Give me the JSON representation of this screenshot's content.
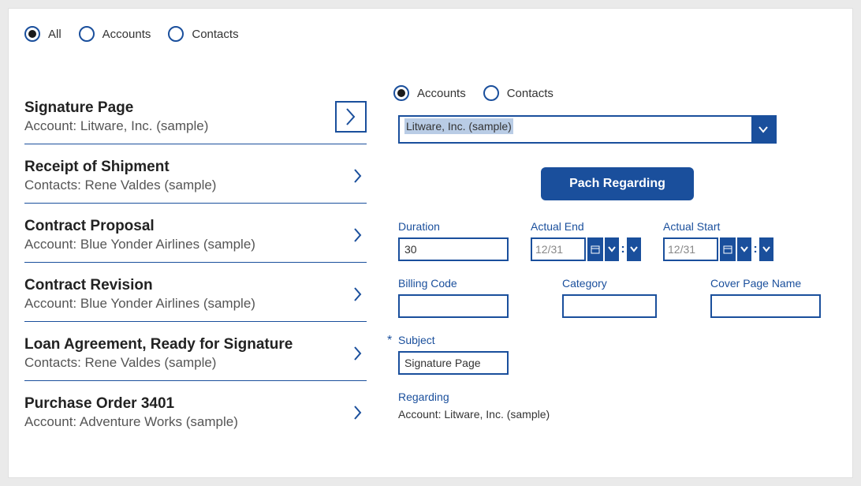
{
  "topFilters": {
    "all": "All",
    "accounts": "Accounts",
    "contacts": "Contacts",
    "selected": "all"
  },
  "list": [
    {
      "title": "Signature Page",
      "sub": "Account: Litware, Inc. (sample)",
      "boxed": true
    },
    {
      "title": "Receipt of Shipment",
      "sub": "Contacts: Rene Valdes (sample)",
      "boxed": false
    },
    {
      "title": "Contract Proposal",
      "sub": "Account: Blue Yonder Airlines (sample)",
      "boxed": false
    },
    {
      "title": "Contract Revision",
      "sub": "Account: Blue Yonder Airlines (sample)",
      "boxed": false
    },
    {
      "title": "Loan Agreement, Ready for Signature",
      "sub": "Contacts: Rene Valdes (sample)",
      "boxed": false
    },
    {
      "title": "Purchase Order 3401",
      "sub": "Account: Adventure Works (sample)",
      "boxed": false
    }
  ],
  "rightFilters": {
    "accounts": "Accounts",
    "contacts": "Contacts",
    "selected": "accounts"
  },
  "dropdown": {
    "value": "Litware, Inc. (sample)"
  },
  "actionButton": "Pach Regarding",
  "fields": {
    "duration": {
      "label": "Duration",
      "value": "30"
    },
    "actualEnd": {
      "label": "Actual End",
      "value": "12/31"
    },
    "actualStart": {
      "label": "Actual Start",
      "value": "12/31"
    },
    "billingCode": {
      "label": "Billing Code",
      "value": ""
    },
    "category": {
      "label": "Category",
      "value": ""
    },
    "coverPage": {
      "label": "Cover Page Name",
      "value": ""
    },
    "subject": {
      "label": "Subject",
      "value": "Signature Page"
    }
  },
  "regarding": {
    "label": "Regarding",
    "value": "Account: Litware, Inc. (sample)"
  }
}
